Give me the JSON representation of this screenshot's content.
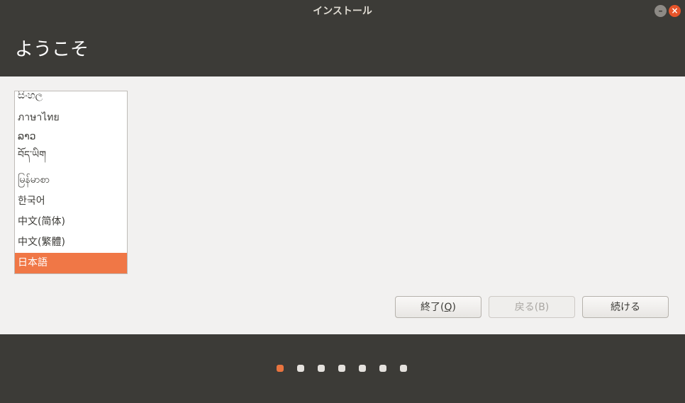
{
  "window": {
    "title": "インストール",
    "minimize_glyph": "–",
    "close_glyph": "×"
  },
  "header": {
    "title": "ようこそ"
  },
  "languages": {
    "items": [
      {
        "label": "සිංහල",
        "selected": false
      },
      {
        "label": "ภาษาไทย",
        "selected": false
      },
      {
        "label": "ລາວ",
        "selected": false
      },
      {
        "label": "བོད་ཡིག",
        "selected": false
      },
      {
        "label": "မြန်မာစာ",
        "selected": false
      },
      {
        "label": "한국어",
        "selected": false
      },
      {
        "label": "中文(简体)",
        "selected": false
      },
      {
        "label": "中文(繁體)",
        "selected": false
      },
      {
        "label": "日本語",
        "selected": true
      }
    ],
    "selected_color": "#f07746"
  },
  "buttons": {
    "quit_label_pre": "終了(",
    "quit_label_mnemonic": "Q",
    "quit_label_post": ")",
    "back_label": "戻る(B)",
    "back_enabled": false,
    "continue_label": "続ける"
  },
  "progress": {
    "total_steps": 7,
    "current_step": 1,
    "active_color": "#e9743f"
  },
  "colors": {
    "chrome": "#3c3b37",
    "content_bg": "#f2f1f0",
    "accent": "#e9743f"
  }
}
